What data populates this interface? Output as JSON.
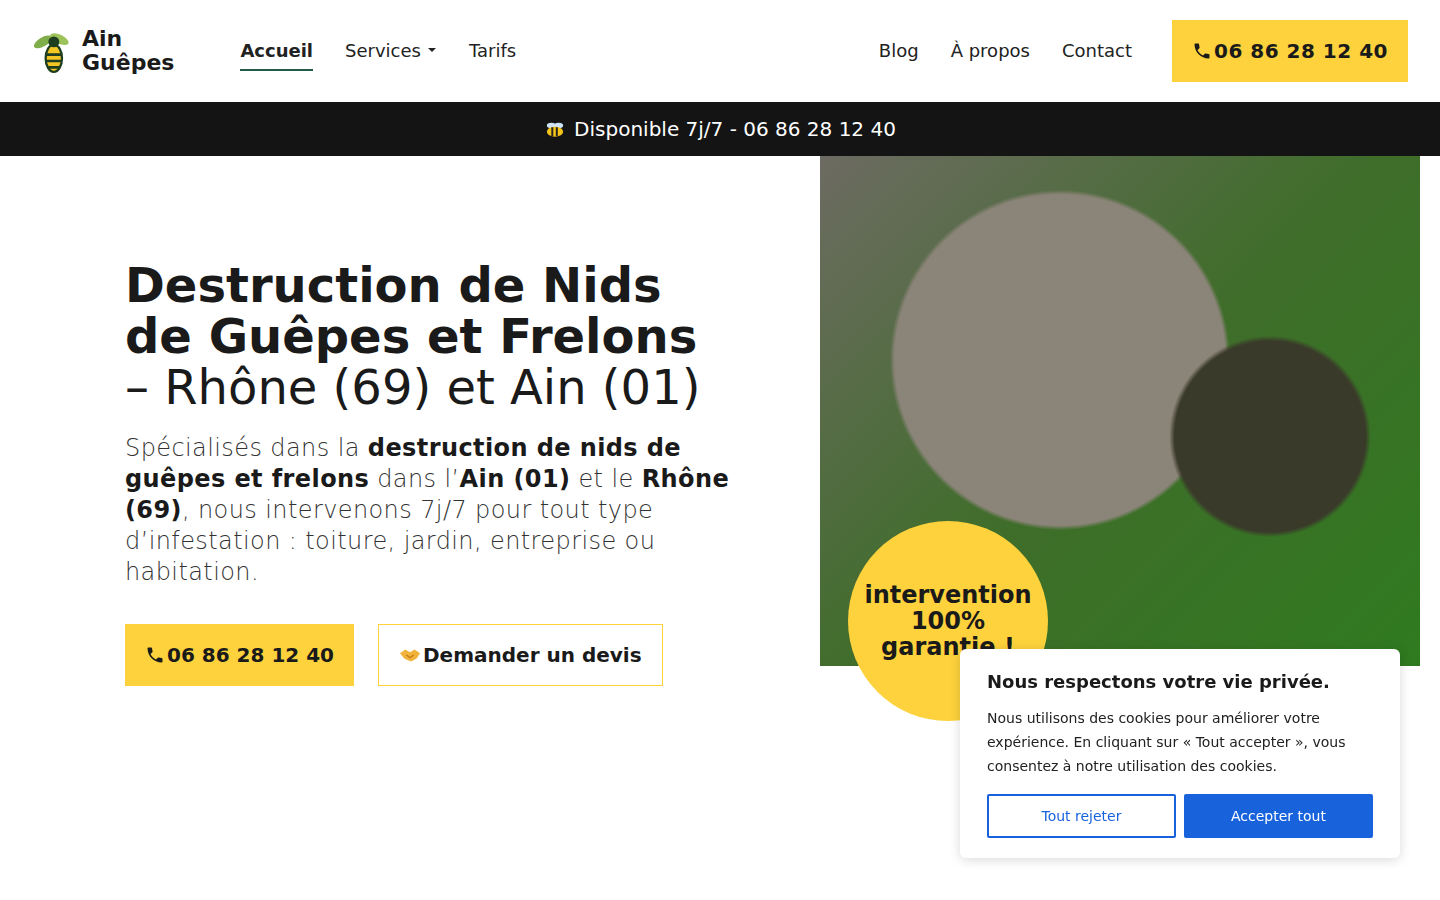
{
  "header": {
    "logo": [
      "Ain",
      "Guêpes"
    ],
    "nav_left": [
      {
        "label": "Accueil",
        "selected": true,
        "dropdown": false
      },
      {
        "label": "Services",
        "selected": false,
        "dropdown": true
      },
      {
        "label": "Tarifs",
        "selected": false,
        "dropdown": false
      }
    ],
    "nav_right": [
      {
        "label": "Blog",
        "selected": false
      },
      {
        "label": "À propos",
        "selected": false
      },
      {
        "label": "Contact",
        "selected": false
      }
    ],
    "phone_button": "06 86 28 12 40"
  },
  "announcement": "Disponible 7j/7 - 06 86 28 12 40",
  "hero": {
    "title_bold": "Destruction de Nids de Guêpes et Frelons",
    "title_regular": "– Rhône (69) et Ain (01)",
    "description": [
      {
        "text": "Spécialisés dans la ",
        "bold": false
      },
      {
        "text": "destruction de nids de guêpes et frelons",
        "bold": true
      },
      {
        "text": " dans l’",
        "bold": false
      },
      {
        "text": "Ain (01)",
        "bold": true
      },
      {
        "text": " et le ",
        "bold": false
      },
      {
        "text": "Rhône (69)",
        "bold": true
      },
      {
        "text": ", nous intervenons 7j/7 pour tout type d’infestation : toiture, jardin, entreprise ou habitation.",
        "bold": false
      }
    ],
    "call_button": "06 86 28 12 40",
    "quote_button": "Demander un devis",
    "badge": "intervention 100% garantie !"
  },
  "cookie_banner": {
    "title": "Nous respectons votre vie privée.",
    "text": "Nous utilisons des cookies pour améliorer votre expérience. En cliquant sur « Tout accepter », vous consentez à notre utilisation des cookies.",
    "reject": "Tout rejeter",
    "accept": "Accepter tout"
  }
}
